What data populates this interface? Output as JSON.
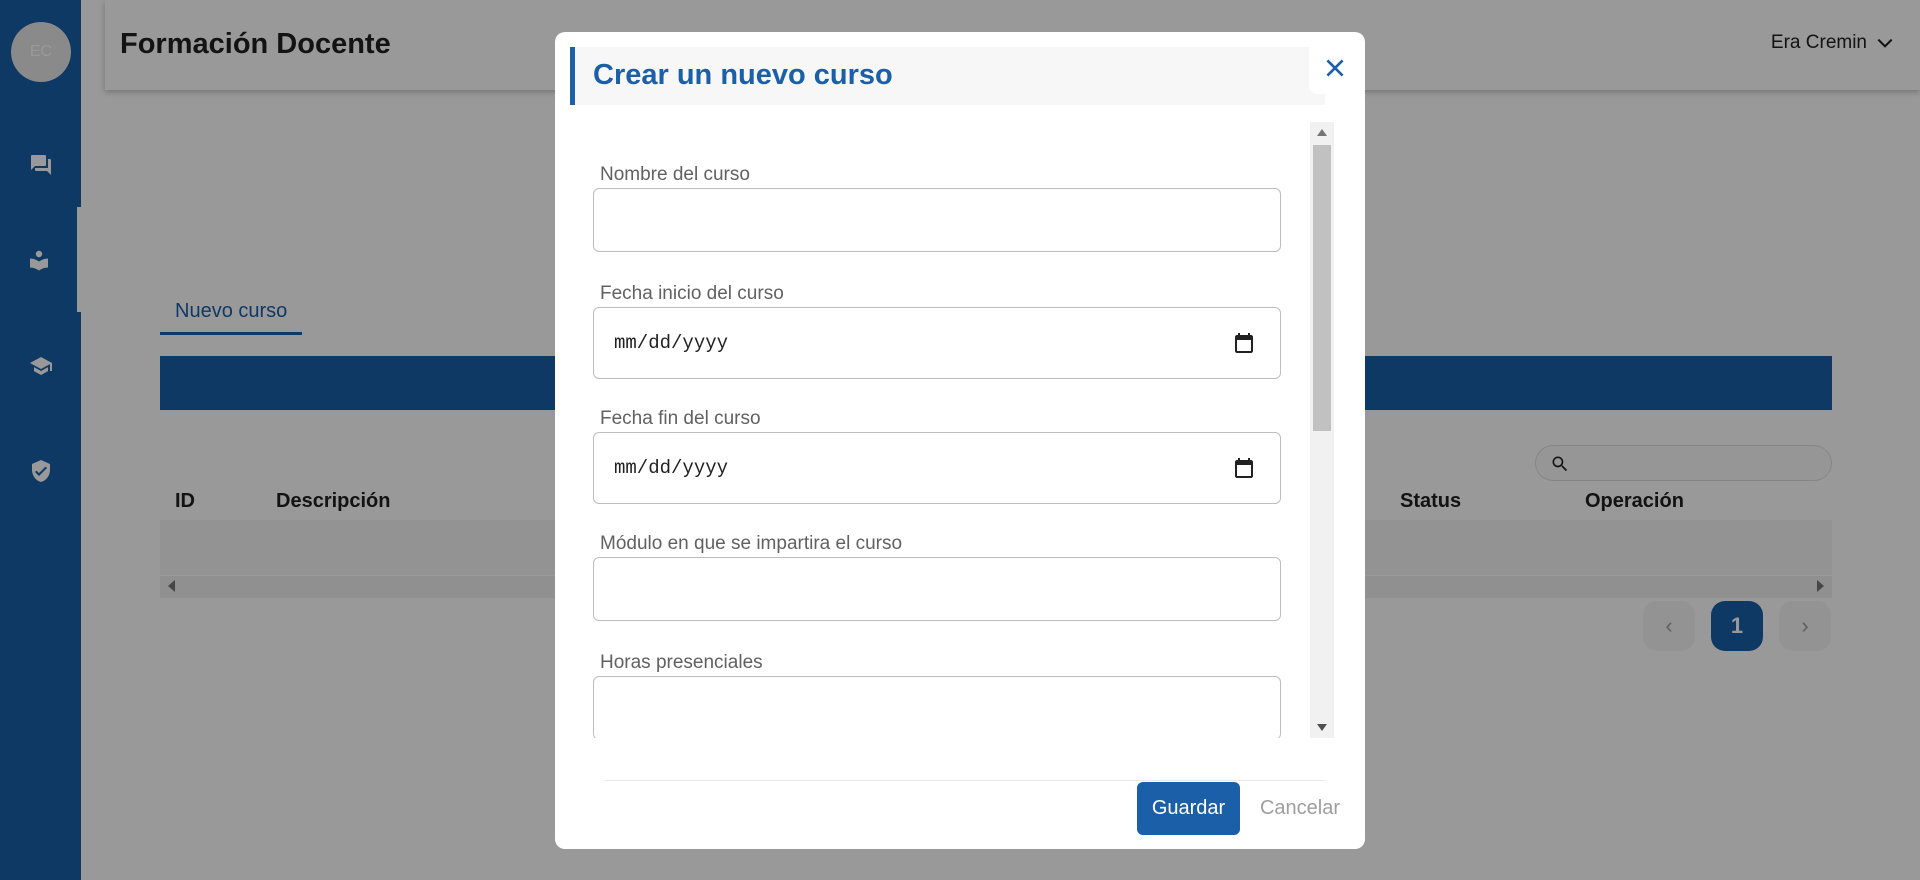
{
  "app": {
    "title": "Formación Docente",
    "user_name": "Era Cremin",
    "avatar_initials": "EC"
  },
  "sidebar": {
    "items": [
      {
        "icon": "chat-icon",
        "active": false
      },
      {
        "icon": "reader-icon",
        "active": true
      },
      {
        "icon": "school-icon",
        "active": false
      },
      {
        "icon": "verified-shield-icon",
        "active": false
      }
    ]
  },
  "page": {
    "tab_label": "Nuevo curso",
    "table": {
      "headers": [
        "ID",
        "Descripción",
        "Status",
        "Operación"
      ],
      "rows": []
    },
    "pagination": {
      "current_page": "1"
    }
  },
  "modal": {
    "title": "Crear un nuevo curso",
    "fields": [
      {
        "label": "Nombre del curso",
        "value": "",
        "type": "text"
      },
      {
        "label": "Fecha inicio del curso",
        "value": "mm/dd/yyyy",
        "type": "date"
      },
      {
        "label": "Fecha fin del curso",
        "value": "mm/dd/yyyy",
        "type": "date"
      },
      {
        "label": "Módulo en que se impartira el curso",
        "value": "",
        "type": "text"
      },
      {
        "label": "Horas presenciales",
        "value": "",
        "type": "text"
      }
    ],
    "save_label": "Guardar",
    "cancel_label": "Cancelar"
  },
  "colors": {
    "primary": "#1a5fa8",
    "overlay": "rgba(0,0,0,0.4)"
  }
}
